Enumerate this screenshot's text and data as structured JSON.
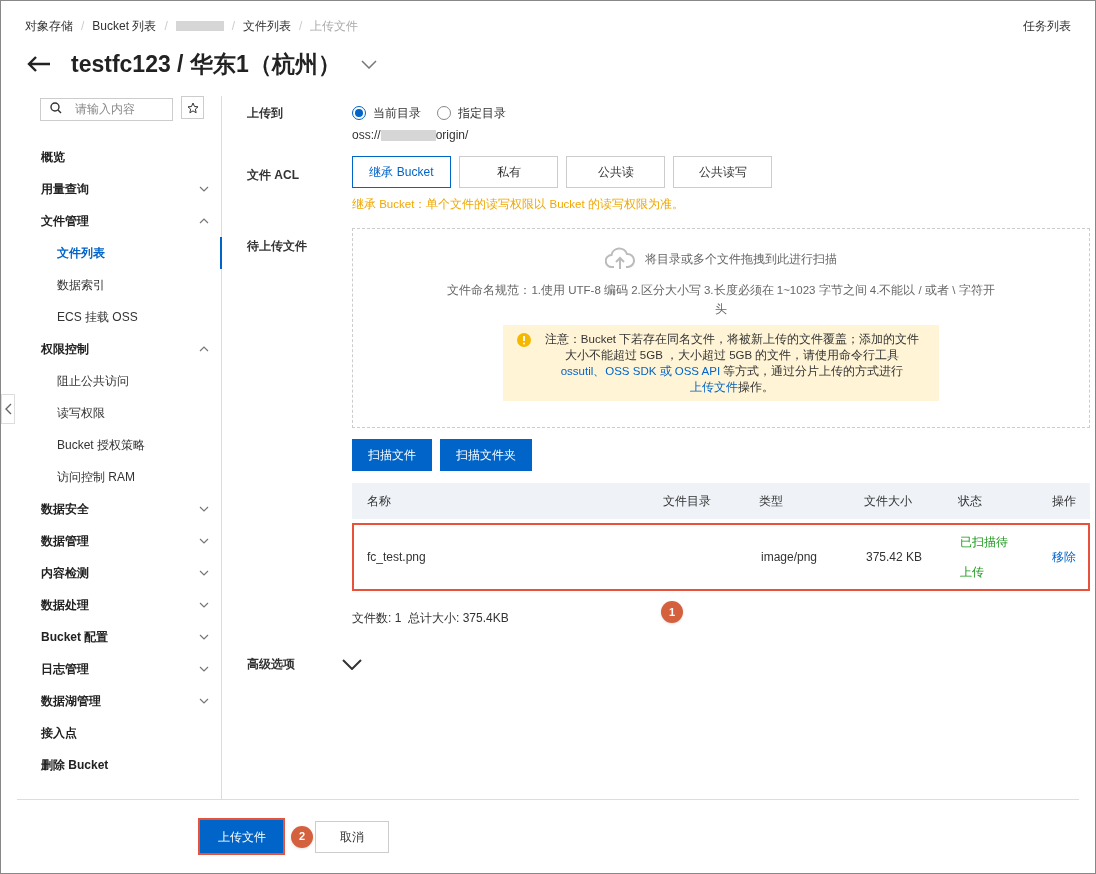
{
  "breadcrumb_separator": "/",
  "breadcrumbs": [
    {
      "kind": "link",
      "label": "对象存储"
    },
    {
      "kind": "link",
      "label": "Bucket 列表"
    },
    {
      "kind": "redacted"
    },
    {
      "kind": "link",
      "label": "文件列表"
    },
    {
      "kind": "current",
      "label": "上传文件"
    }
  ],
  "task_list": "任务列表",
  "title": "testfc123 / 华东1（杭州）",
  "search": {
    "placeholder": "请输入内容"
  },
  "sidebar": [
    {
      "label": "概览"
    },
    {
      "label": "用量查询",
      "expanded": false
    },
    {
      "label": "文件管理",
      "expanded": true,
      "children": [
        {
          "label": "文件列表",
          "selected": true
        },
        {
          "label": "数据索引",
          "selected": false
        },
        {
          "label": "ECS 挂载 OSS",
          "selected": false
        }
      ]
    },
    {
      "label": "权限控制",
      "expanded": true,
      "children": [
        {
          "label": "阻止公共访问",
          "selected": false
        },
        {
          "label": "读写权限",
          "selected": false
        },
        {
          "label": "Bucket 授权策略",
          "selected": false
        },
        {
          "label": "访问控制 RAM",
          "selected": false
        }
      ]
    },
    {
      "label": "数据安全",
      "expanded": false
    },
    {
      "label": "数据管理",
      "expanded": false
    },
    {
      "label": "内容检测",
      "expanded": false
    },
    {
      "label": "数据处理",
      "expanded": false
    },
    {
      "label": "Bucket 配置",
      "expanded": false
    },
    {
      "label": "日志管理",
      "expanded": false
    },
    {
      "label": "数据湖管理",
      "expanded": false
    },
    {
      "label": "接入点"
    },
    {
      "label": "删除 Bucket"
    }
  ],
  "upload_to": {
    "label": "上传到",
    "options": [
      {
        "label": "当前目录",
        "selected": true
      },
      {
        "label": "指定目录",
        "selected": false
      }
    ],
    "path_prefix": "oss://",
    "path_suffix": "origin/"
  },
  "acl": {
    "label": "文件 ACL",
    "options": [
      {
        "label": "继承 Bucket",
        "selected": true
      },
      {
        "label": "私有",
        "selected": false
      },
      {
        "label": "公共读",
        "selected": false
      },
      {
        "label": "公共读写",
        "selected": false
      }
    ],
    "hint": "继承 Bucket：单个文件的读写权限以 Bucket 的读写权限为准。"
  },
  "files": {
    "label": "待上传文件",
    "drop_text": "将目录或多个文件拖拽到此进行扫描",
    "naming_rule": "文件命名规范：1.使用 UTF-8 编码 2.区分大小写 3.长度必须在 1~1023 字节之间 4.不能以 / 或者 \\ 字符开头",
    "notice": [
      {
        "kind": "text",
        "text": "注意：Bucket 下若存在同名文件，将被新上传的文件覆盖；添加的文件大小不能超过 5GB ，大小超过 5GB 的文件，请使用命令行工具 "
      },
      {
        "kind": "link",
        "text": "ossutil、OSS SDK 或 OSS API"
      },
      {
        "kind": "text",
        "text": " 等方式，通过分片上传的方式进行"
      },
      {
        "kind": "link",
        "text": "上传文件"
      },
      {
        "kind": "text",
        "text": "操作。"
      }
    ],
    "buttons": [
      "扫描文件",
      "扫描文件夹"
    ]
  },
  "table": {
    "columns": [
      "名称",
      "文件目录",
      "类型",
      "文件大小",
      "状态",
      "操作"
    ],
    "rows": [
      {
        "name": "fc_test.png",
        "type": "image/png",
        "size": "375.42 KB",
        "status": "已扫描待上传",
        "action": "移除",
        "highlighted": true
      }
    ],
    "callout": "1"
  },
  "summary": "文件数: 1  总计大小: 375.4KB",
  "advanced": {
    "label": "高级选项",
    "expanded": false
  },
  "footer": {
    "submit": "上传文件",
    "submit_highlighted": true,
    "callout": "2",
    "cancel": "取消"
  }
}
